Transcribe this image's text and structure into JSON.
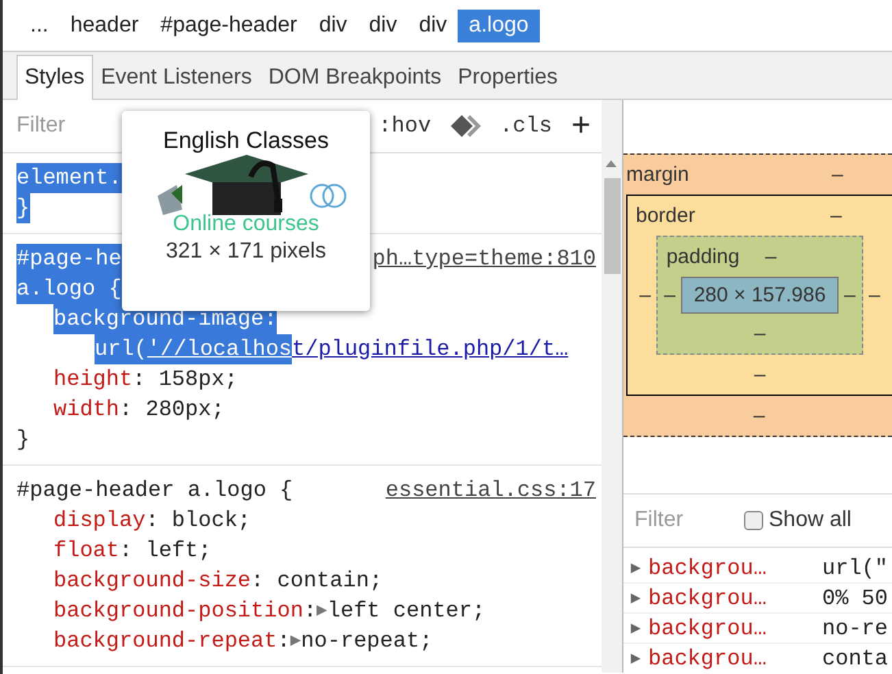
{
  "breadcrumbs": [
    {
      "label": "...",
      "selected": false
    },
    {
      "label": "header",
      "selected": false
    },
    {
      "label": "#page-header",
      "selected": false
    },
    {
      "label": "div",
      "selected": false
    },
    {
      "label": "div",
      "selected": false
    },
    {
      "label": "div",
      "selected": false
    },
    {
      "label": "a.logo",
      "selected": true
    }
  ],
  "tabs": [
    {
      "label": "Styles",
      "selected": true
    },
    {
      "label": "Event Listeners",
      "selected": false
    },
    {
      "label": "DOM Breakpoints",
      "selected": false
    },
    {
      "label": "Properties",
      "selected": false
    }
  ],
  "styles_toolbar": {
    "filter": {
      "placeholder": "Filter"
    },
    "hov": ":hov",
    "cls": ".cls",
    "add": "+"
  },
  "rules": [
    {
      "lines": [
        {
          "kind": "selector",
          "segments": [
            {
              "text": "element.",
              "kind": "selector",
              "highlighted": true
            }
          ]
        },
        {
          "kind": "close",
          "segments": [
            {
              "text": "}",
              "kind": "selector",
              "highlighted": true
            }
          ]
        }
      ]
    },
    {
      "lines": [
        {
          "kind": "selector",
          "source": "ph…type=theme:810",
          "segments": [
            {
              "text": "#page-he",
              "kind": "selector",
              "highlighted": true
            }
          ]
        },
        {
          "kind": "selector",
          "segments": [
            {
              "text": "a.logo {",
              "kind": "selector",
              "highlighted": true
            }
          ]
        },
        {
          "kind": "declaration",
          "segments": [
            {
              "text": "background-image:",
              "kind": "property",
              "highlighted": true
            }
          ]
        },
        {
          "kind": "continuation",
          "segments": [
            {
              "text": "url(",
              "kind": "value",
              "highlighted": true
            },
            {
              "text": "'//localhos",
              "kind": "link",
              "highlighted": true
            },
            {
              "text": "t/pluginfile.php/1/t…",
              "kind": "link",
              "highlighted": false
            }
          ]
        },
        {
          "kind": "declaration",
          "segments": [
            {
              "text": "height",
              "kind": "property",
              "highlighted": false
            },
            {
              "text": ": 158px;",
              "kind": "value",
              "highlighted": false
            }
          ]
        },
        {
          "kind": "declaration",
          "segments": [
            {
              "text": "width",
              "kind": "property",
              "highlighted": false
            },
            {
              "text": ": 280px;",
              "kind": "value",
              "highlighted": false
            }
          ]
        },
        {
          "kind": "close",
          "segments": [
            {
              "text": "}",
              "kind": "selector",
              "highlighted": false
            }
          ]
        }
      ]
    },
    {
      "lines": [
        {
          "kind": "selector",
          "source": "essential.css:17",
          "segments": [
            {
              "text": "#page-header a.logo {",
              "kind": "selector",
              "highlighted": false
            }
          ]
        },
        {
          "kind": "declaration",
          "segments": [
            {
              "text": "display",
              "kind": "property",
              "highlighted": false
            },
            {
              "text": ": block;",
              "kind": "value",
              "highlighted": false
            }
          ]
        },
        {
          "kind": "declaration",
          "segments": [
            {
              "text": "float",
              "kind": "property",
              "highlighted": false
            },
            {
              "text": ": left;",
              "kind": "value",
              "highlighted": false
            }
          ]
        },
        {
          "kind": "declaration",
          "segments": [
            {
              "text": "background-size",
              "kind": "property",
              "highlighted": false
            },
            {
              "text": ": contain;",
              "kind": "value",
              "highlighted": false
            }
          ]
        },
        {
          "kind": "declaration",
          "segments": [
            {
              "text": "background-position",
              "kind": "property",
              "highlighted": false
            },
            {
              "text": ":",
              "kind": "value",
              "highlighted": false
            },
            {
              "text": "▶",
              "kind": "toggle",
              "highlighted": false
            },
            {
              "text": "left center;",
              "kind": "value",
              "highlighted": false
            }
          ]
        },
        {
          "kind": "declaration",
          "segments": [
            {
              "text": "background-repeat",
              "kind": "property",
              "highlighted": false
            },
            {
              "text": ":",
              "kind": "value",
              "highlighted": false
            },
            {
              "text": "▶",
              "kind": "toggle",
              "highlighted": false
            },
            {
              "text": "no-repeat;",
              "kind": "value",
              "highlighted": false
            }
          ]
        }
      ]
    }
  ],
  "tooltip": {
    "logo_title": "English Classes",
    "logo_caption": "Online courses",
    "size": "321 × 171 pixels"
  },
  "box_model": {
    "margin": {
      "label": "margin",
      "top": "–",
      "bottom": "–"
    },
    "border": {
      "label": "border",
      "top": "–",
      "bottom": "–",
      "left": "–",
      "right": "–"
    },
    "padding": {
      "label": "padding",
      "top": "–",
      "bottom": "–",
      "left": "–",
      "right": "–"
    },
    "content": "280 × 157.986"
  },
  "computed": {
    "filter": {
      "placeholder": "Filter"
    },
    "show_all": {
      "label": "Show all",
      "checked": false
    },
    "rows": [
      {
        "toggle": "▶",
        "name": "backgrou…",
        "value": "url(\""
      },
      {
        "toggle": "▶",
        "name": "backgrou…",
        "value": "0% 50"
      },
      {
        "toggle": "▶",
        "name": "backgrou…",
        "value": "no-re"
      },
      {
        "toggle": "▶",
        "name": "backgrou…",
        "value": "conta"
      }
    ]
  }
}
